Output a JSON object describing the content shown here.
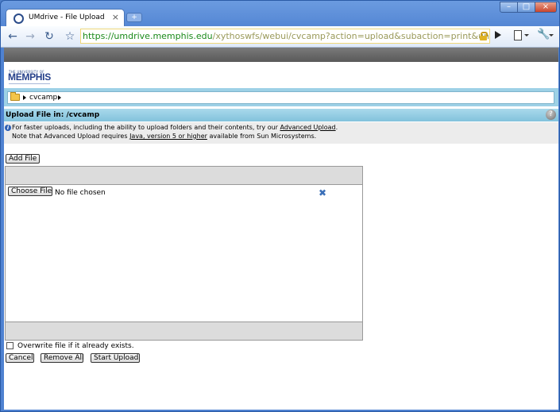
{
  "browser": {
    "tab_title": "UMdrive - File Upload",
    "tab_close": "×",
    "new_tab": "+",
    "url_host": "https://umdrive.memphis.edu",
    "url_path": "/xythoswfs/webui/cvcamp?action=upload&subaction=print&uniq=lqosxi&stk="
  },
  "brand": {
    "small": "THE UNIVERSITY OF",
    "name": "MEMPHIS"
  },
  "breadcrumb": {
    "folder": "cvcamp"
  },
  "upload_bar": {
    "label": "Upload File in:  /cvcamp"
  },
  "info": {
    "line1_prefix": "For faster uploads, including the ability to upload folders and their contents, try our ",
    "line1_link": "Advanced Upload",
    "line1_suffix": ".",
    "line2_prefix": "Note that Advanced Upload requires ",
    "line2_link": "Java, version 5 or higher",
    "line2_suffix": " available from Sun Microsystems."
  },
  "buttons": {
    "add_file": "Add File",
    "choose_file": "Choose File",
    "cancel": "Cancel",
    "remove_all": "Remove All",
    "start_upload": "Start Upload"
  },
  "file_row": {
    "status": "No file chosen"
  },
  "options": {
    "overwrite_label": "Overwrite file if it already exists.",
    "overwrite_checked": false
  }
}
